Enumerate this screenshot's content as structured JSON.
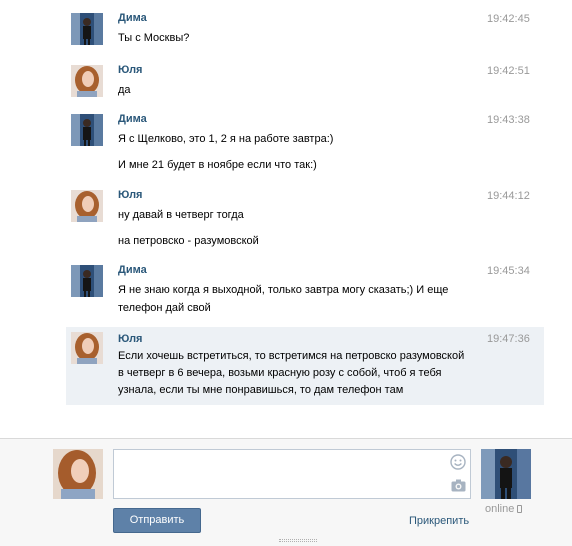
{
  "colors": {
    "author_link": "#2b587a",
    "time": "#999999",
    "highlight_row": "#edf1f5",
    "send_button": "#5e81a8",
    "composer_bg": "#f7f7f7"
  },
  "messages": [
    {
      "author": "Дима",
      "time": "19:42:45",
      "lines": [
        "Ты с Москвы?"
      ]
    },
    {
      "author": "Юля",
      "time": "19:42:51",
      "lines": [
        "да"
      ]
    },
    {
      "author": "Дима",
      "time": "19:43:38",
      "lines": [
        "Я с Щелково, это 1, 2 я на работе завтра:)",
        "И мне 21 будет в ноябре если что так:)"
      ]
    },
    {
      "author": "Юля",
      "time": "19:44:12",
      "lines": [
        "ну давай в четверг тогда",
        "на петровско - разумовской"
      ]
    },
    {
      "author": "Дима",
      "time": "19:45:34",
      "lines": [
        "Я не знаю когда я выходной, только завтра могу сказать;) И еще",
        "телефон дай свой"
      ]
    },
    {
      "author": "Юля",
      "time": "19:47:36",
      "lines": [
        "Если хочешь встретиться, то встретимся на петровско разумовской",
        "в четверг в 6 вечера, возьми красную розу с собой, чтоб я тебя",
        "узнала, если ты мне понравишься, то дам телефон там"
      ]
    }
  ],
  "composer": {
    "send_label": "Отправить",
    "attach_label": "Прикрепить",
    "peer_status": "online",
    "icons": [
      "smile-icon",
      "camera-icon",
      "phone-icon"
    ]
  }
}
